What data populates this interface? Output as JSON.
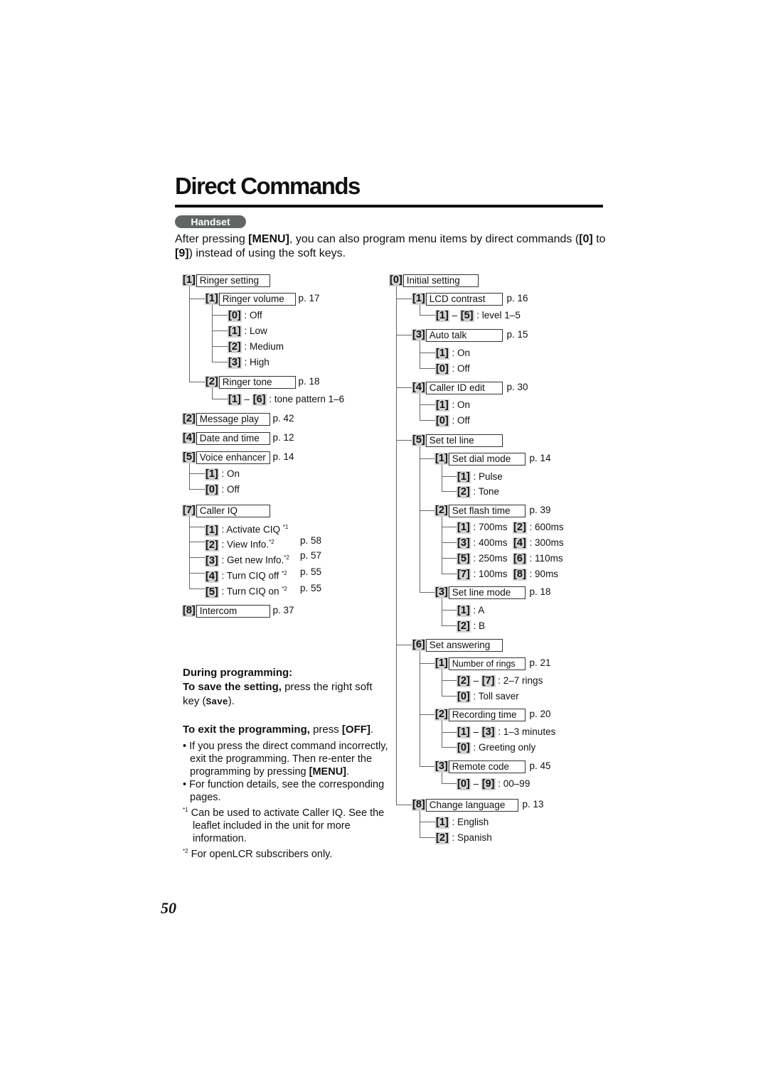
{
  "page": {
    "title": "Direct Commands",
    "section_badge": "Handset",
    "intro": {
      "t1": "After pressing ",
      "k1": "[MENU]",
      "t2": ", you can also program menu items by direct commands (",
      "k2": "[0]",
      "t3": " to ",
      "k3": "[9]",
      "t4": ") instead of using the soft keys."
    },
    "page_number": "50"
  },
  "left_tree": {
    "ringer": {
      "key": "[1]",
      "label": "Ringer setting",
      "volume": {
        "key": "[1]",
        "label": "Ringer volume",
        "page": "p. 17",
        "options": [
          {
            "key": "[0]",
            "text": ": Off"
          },
          {
            "key": "[1]",
            "text": ": Low"
          },
          {
            "key": "[2]",
            "text": ": Medium"
          },
          {
            "key": "[3]",
            "text": ": High"
          }
        ]
      },
      "tone": {
        "key": "[2]",
        "label": "Ringer tone",
        "page": "p. 18",
        "range": {
          "k1": "[1]",
          "dash": "–",
          "k2": "[6]",
          "text": ": tone pattern 1–6"
        }
      }
    },
    "message": {
      "key": "[2]",
      "label": "Message play",
      "page": "p. 42"
    },
    "datetime": {
      "key": "[4]",
      "label": "Date and time",
      "page": "p. 12"
    },
    "voice": {
      "key": "[5]",
      "label": "Voice enhancer",
      "page": "p. 14",
      "options": [
        {
          "key": "[1]",
          "text": ": On"
        },
        {
          "key": "[0]",
          "text": ": Off"
        }
      ]
    },
    "calleriq": {
      "key": "[7]",
      "label": "Caller IQ",
      "options": [
        {
          "key": "[1]",
          "text": ": Activate CIQ",
          "note": "*1",
          "page": ""
        },
        {
          "key": "[2]",
          "text": ": View Info.",
          "note": "*2",
          "page": "p. 58"
        },
        {
          "key": "[3]",
          "text": ": Get new Info.",
          "note": "*2",
          "page": "p. 57"
        },
        {
          "key": "[4]",
          "text": ": Turn CIQ off",
          "note": "*2",
          "page": "p. 55"
        },
        {
          "key": "[5]",
          "text": ": Turn CIQ on",
          "note": "*2",
          "page": "p. 55"
        }
      ]
    },
    "intercom": {
      "key": "[8]",
      "label": "Intercom",
      "page": "p. 37"
    }
  },
  "right_tree": {
    "initial": {
      "key": "[0]",
      "label": "Initial setting"
    },
    "lcd": {
      "key": "[1]",
      "label": "LCD contrast",
      "page": "p. 16",
      "range": {
        "k1": "[1]",
        "dash": "–",
        "k2": "[5]",
        "text": ": level 1–5"
      }
    },
    "autotalk": {
      "key": "[3]",
      "label": "Auto talk",
      "page": "p. 15",
      "options": [
        {
          "key": "[1]",
          "text": ": On"
        },
        {
          "key": "[0]",
          "text": ": Off"
        }
      ]
    },
    "callerid": {
      "key": "[4]",
      "label": "Caller ID edit",
      "page": "p. 30",
      "options": [
        {
          "key": "[1]",
          "text": ": On"
        },
        {
          "key": "[0]",
          "text": ": Off"
        }
      ]
    },
    "telline": {
      "key": "[5]",
      "label": "Set tel line",
      "dial": {
        "key": "[1]",
        "label": "Set dial mode",
        "page": "p. 14",
        "options": [
          {
            "key": "[1]",
            "text": ": Pulse"
          },
          {
            "key": "[2]",
            "text": ": Tone"
          }
        ]
      },
      "flash": {
        "key": "[2]",
        "label": "Set flash time",
        "page": "p. 39",
        "rows": [
          {
            "k1": "[1]",
            "t1": ": 700ms",
            "k2": "[2]",
            "t2": ": 600ms"
          },
          {
            "k1": "[3]",
            "t1": ": 400ms",
            "k2": "[4]",
            "t2": ": 300ms"
          },
          {
            "k1": "[5]",
            "t1": ": 250ms",
            "k2": "[6]",
            "t2": ": 110ms"
          },
          {
            "k1": "[7]",
            "t1": ": 100ms",
            "k2": "[8]",
            "t2": ": 90ms"
          }
        ]
      },
      "line": {
        "key": "[3]",
        "label": "Set line mode",
        "page": "p. 18",
        "options": [
          {
            "key": "[1]",
            "text": ": A"
          },
          {
            "key": "[2]",
            "text": ": B"
          }
        ]
      }
    },
    "answering": {
      "key": "[6]",
      "label": "Set answering",
      "rings": {
        "key": "[1]",
        "label": "Number of rings",
        "page": "p. 21",
        "range": {
          "k1": "[2]",
          "dash": "–",
          "k2": "[7]",
          "text": ": 2–7 rings"
        },
        "option": {
          "key": "[0]",
          "text": ": Toll saver"
        }
      },
      "rec": {
        "key": "[2]",
        "label": "Recording time",
        "page": "p. 20",
        "range": {
          "k1": "[1]",
          "dash": "–",
          "k2": "[3]",
          "text": ": 1–3 minutes"
        },
        "option": {
          "key": "[0]",
          "text": ": Greeting only"
        }
      },
      "remote": {
        "key": "[3]",
        "label": "Remote code",
        "page": "p. 45",
        "range": {
          "k1": "[0]",
          "dash": "–",
          "k2": "[9]",
          "text": ": 00–99"
        }
      }
    },
    "language": {
      "key": "[8]",
      "label": "Change language",
      "page": "p. 13",
      "options": [
        {
          "key": "[1]",
          "text": ": English"
        },
        {
          "key": "[2]",
          "text": ": Spanish"
        }
      ]
    }
  },
  "notes": {
    "heading": "During programming:",
    "save_bold": "To save the setting,",
    "save_text": " press the right soft key (",
    "save_key": "Save",
    "save_end": ").",
    "exit_bold": "To exit the programming,",
    "exit_text": " press ",
    "exit_key": "[OFF]",
    "exit_end": ".",
    "bullet1_a": "If you press the direct command incorrectly, exit the programming. Then re-enter the programming by pressing ",
    "bullet1_key": "[MENU]",
    "bullet1_end": ".",
    "bullet2": "For function details, see the corresponding pages.",
    "fn1_mark": "*1",
    "fn1": "Can be used to activate Caller IQ. See the leaflet included in the unit for more information.",
    "fn2_mark": "*2",
    "fn2": "For openLCR subscribers only."
  }
}
